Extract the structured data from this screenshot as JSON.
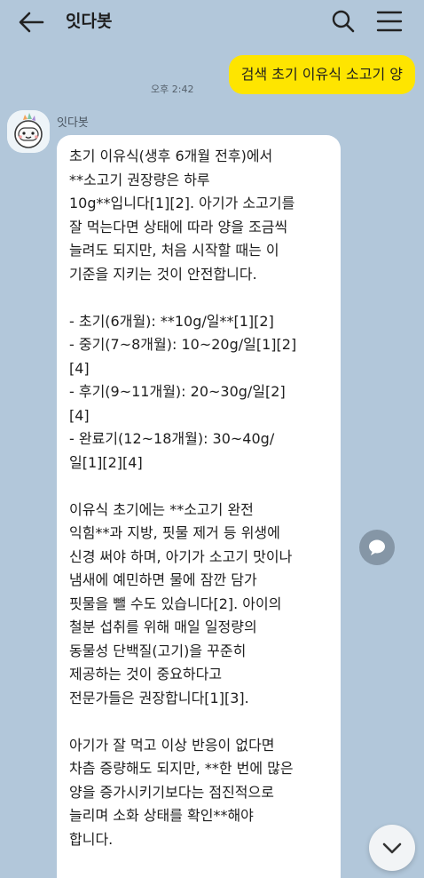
{
  "header": {
    "title": "잇다봇",
    "back_icon": "arrow-left-icon",
    "search_icon": "search-icon",
    "menu_icon": "hamburger-menu-icon"
  },
  "outgoing": {
    "text": "검색 초기 이유식 소고기 양",
    "time": "오후 2:42",
    "bubble_color": "#fee500"
  },
  "incoming": {
    "sender": "잇다봇",
    "avatar_icon": "bot-avatar-icon",
    "text": "초기 이유식(생후 6개월 전후)에서\n**소고기 권장량은 하루\n10g**입니다[1][2]. 아기가 소고기를\n잘 먹는다면 상태에 따라 양을 조금씩\n늘려도 되지만, 처음 시작할 때는 이\n기준을 지키는 것이 안전합니다.\n\n- 초기(6개월): **10g/일**[1][2]\n- 중기(7~8개월): 10~20g/일[1][2]\n[4]\n- 후기(9~11개월): 20~30g/일[2]\n[4]\n- 완료기(12~18개월): 30~40g/\n일[1][2][4]\n\n이유식 초기에는 **소고기 완전\n익힘**과 지방, 핏물 제거 등 위생에\n신경 써야 하며, 아기가 소고기 맛이나\n냄새에 예민하면 물에 잠깐 담가\n핏물을 뺄 수도 있습니다[2]. 아이의\n철분 섭취를 위해 매일 일정량의\n동물성 단백질(고기)을 꾸준히\n제공하는 것이 중요하다고\n전문가들은 권장합니다[1][3].\n\n아기가 잘 먹고 이상 반응이 없다면\n차츰 증량해도 되지만, **한 번에 많은\n양을 증가시키기보다는 점진적으로\n늘리며 소화 상태를 확인**해야\n합니다."
  },
  "floating": {
    "share_icon": "share-bubble-icon",
    "scroll_icon": "chevron-down-icon"
  },
  "colors": {
    "background": "#b2c7da",
    "bubble_in": "#ffffff",
    "bubble_out": "#fee500"
  }
}
